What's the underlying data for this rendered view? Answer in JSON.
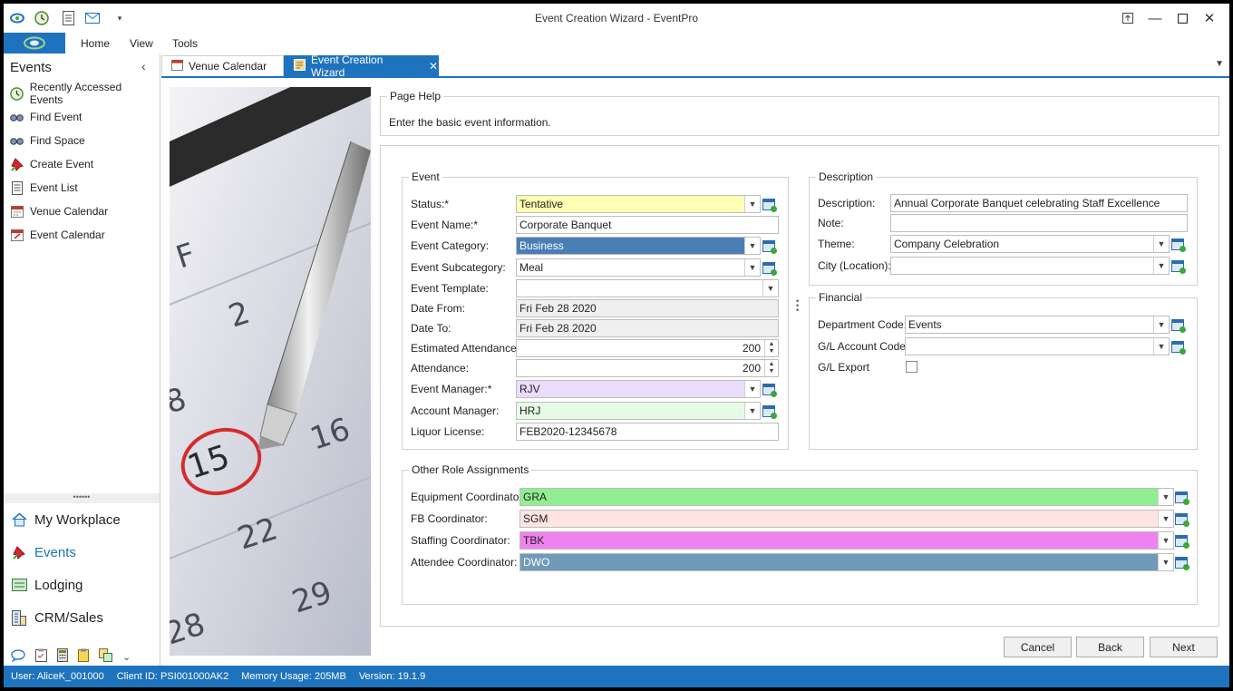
{
  "window": {
    "title": "Event Creation Wizard - EventPro"
  },
  "ribbon": {
    "tabs": [
      "Home",
      "View",
      "Tools"
    ]
  },
  "nav": {
    "title": "Events",
    "items": [
      {
        "label": "Recently Accessed Events",
        "icon": "clock-icon"
      },
      {
        "label": "Find Event",
        "icon": "binoculars-icon"
      },
      {
        "label": "Find Space",
        "icon": "binoculars-icon"
      },
      {
        "label": "Create Event",
        "icon": "pushpin-icon"
      },
      {
        "label": "Event List",
        "icon": "document-list-icon"
      },
      {
        "label": "Venue Calendar",
        "icon": "calendar-icon"
      },
      {
        "label": "Event Calendar",
        "icon": "calendar-icon"
      }
    ],
    "modules": [
      {
        "label": "My Workplace",
        "icon": "house-icon"
      },
      {
        "label": "Events",
        "icon": "pushpin-icon"
      },
      {
        "label": "Lodging",
        "icon": "bed-icon"
      },
      {
        "label": "CRM/Sales",
        "icon": "building-icon"
      }
    ]
  },
  "tabs": [
    {
      "label": "Venue Calendar"
    },
    {
      "label": "Event Creation Wizard"
    }
  ],
  "page_help": {
    "title": "Page Help",
    "text": "Enter the basic event information."
  },
  "event": {
    "title": "Event",
    "status_label": "Status:*",
    "status": "Tentative",
    "name_label": "Event Name:*",
    "name": "Corporate Banquet",
    "category_label": "Event Category:",
    "category": "Business",
    "subcategory_label": "Event Subcategory:",
    "subcategory": "Meal",
    "template_label": "Event Template:",
    "template": "",
    "date_from_label": "Date From:",
    "date_from": "Fri Feb 28 2020",
    "date_to_label": "Date To:",
    "date_to": "Fri Feb 28 2020",
    "est_attendance_label": "Estimated Attendance:",
    "est_attendance": "200",
    "attendance_label": "Attendance:",
    "attendance": "200",
    "manager_label": "Event Manager:*",
    "manager": "RJV",
    "account_manager_label": "Account Manager:",
    "account_manager": "HRJ",
    "liquor_label": "Liquor License:",
    "liquor": "FEB2020-12345678"
  },
  "description": {
    "title": "Description",
    "description_label": "Description:",
    "description": "Annual Corporate Banquet celebrating Staff Excellence",
    "note_label": "Note:",
    "note": "",
    "theme_label": "Theme:",
    "theme": "Company Celebration",
    "city_label": "City (Location):",
    "city": ""
  },
  "financial": {
    "title": "Financial",
    "department_label": "Department Code:",
    "department": "Events",
    "gl_label": "G/L Account Code:",
    "gl": "",
    "gl_export_label": "G/L Export"
  },
  "roles": {
    "title": "Other Role Assignments",
    "items": [
      {
        "label": "Equipment Coordinator:",
        "value": "GRA",
        "color": "#90ee90"
      },
      {
        "label": "FB Coordinator:",
        "value": "SGM",
        "color": "#ffe4e1"
      },
      {
        "label": "Staffing Coordinator:",
        "value": "TBK",
        "color": "#ee82ee"
      },
      {
        "label": "Attendee Coordinator:",
        "value": "DWO",
        "color": "#6f9bb8"
      }
    ]
  },
  "buttons": {
    "cancel": "Cancel",
    "back": "Back",
    "next": "Next"
  },
  "status_bar": {
    "user": "User: AliceK_001000",
    "client": "Client ID: PSI001000AK2",
    "memory": "Memory Usage: 205MB",
    "version": "Version: 19.1.9"
  },
  "colors": {
    "accent": "#1e73be",
    "status_field": "#ffffb3",
    "category_field": "#4a7fb5",
    "manager_field": "#ecdcfc",
    "account_manager_field": "#e6fbe6"
  }
}
